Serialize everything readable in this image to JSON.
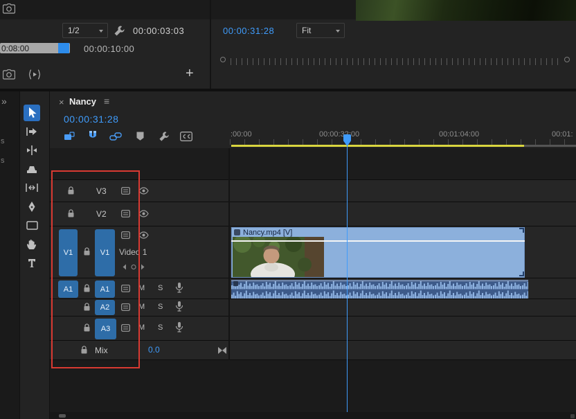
{
  "colors": {
    "accent_blue": "#3f9bfa",
    "scroll_thumb_blue": "#2d8ceb",
    "clip_blue": "#8cb0dc",
    "audio_clip_blue": "#3d5a89",
    "waveform_blue": "#8fb3e2",
    "work_area_yellow": "#d9d53f",
    "highlight_red": "#d93a32",
    "track_target_blue": "#2e6da8"
  },
  "source_monitor": {
    "zoom_select": "1/2",
    "duration": "00:00:03:03",
    "ruler_left_label": "0:08:00",
    "ruler_right_label": "00:00:10:00",
    "add_button": "+"
  },
  "program_monitor": {
    "timecode": "00:00:31:28",
    "zoom_select": "Fit"
  },
  "left_edge": {
    "expand_glyph": "»",
    "fragment_1": "s",
    "fragment_2": "s"
  },
  "tools": [
    "selection-tool",
    "track-select-forward-tool",
    "ripple-edit-tool",
    "razor-tool",
    "slip-tool",
    "pen-tool",
    "rectangle-tool",
    "hand-tool",
    "type-tool"
  ],
  "timeline": {
    "close_glyph": "×",
    "tab_title": "Nancy",
    "panel_menu_glyph": "≡",
    "timecode": "00:00:31:28",
    "ruler_labels": [
      ":00:00",
      "00:00:32:00",
      "00:01:04:00",
      "00:01:"
    ],
    "tracks": {
      "v3_label": "V3",
      "v2_label": "V2",
      "v1_source": "V1",
      "v1_target": "V1",
      "v1_name": "Video 1",
      "a1_source": "A1",
      "a1_target": "A1",
      "a2_target": "A2",
      "a3_target": "A3",
      "mute_label": "M",
      "solo_label": "S",
      "mix_label": "Mix",
      "mix_value": "0.0"
    },
    "video_clip_label": "Nancy.mp4 [V]"
  }
}
